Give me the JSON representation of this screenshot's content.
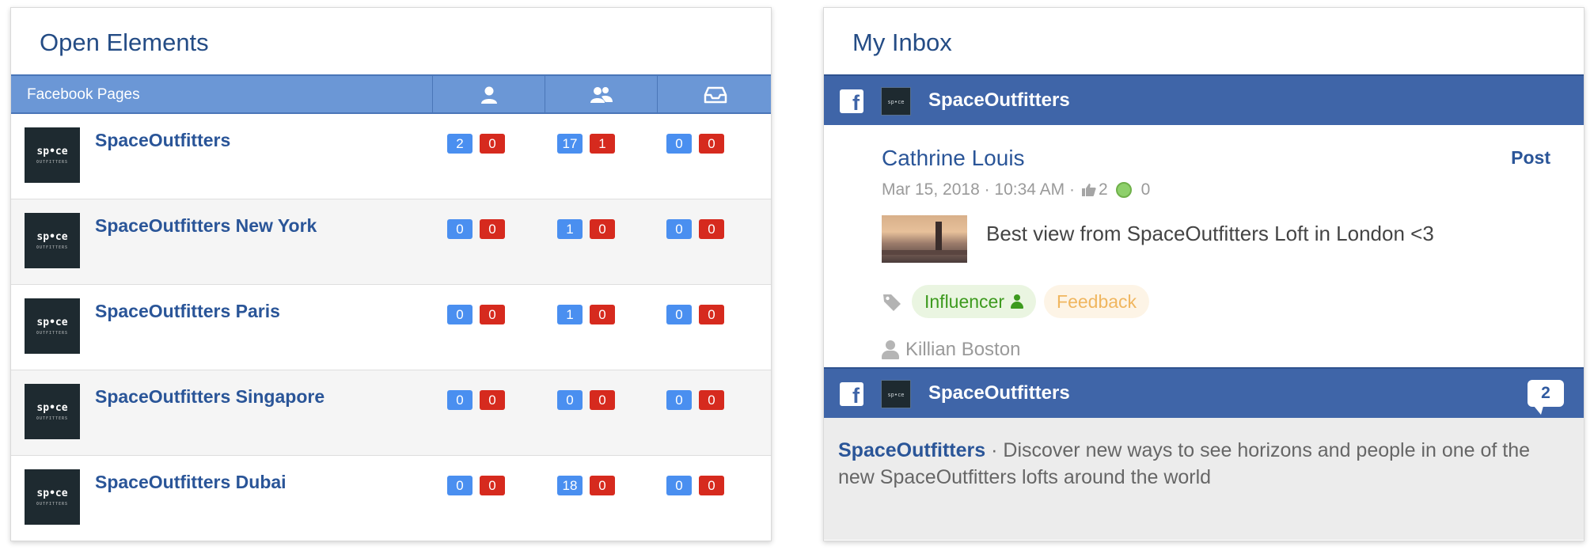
{
  "left_panel": {
    "title": "Open Elements",
    "table": {
      "header_label": "Facebook Pages",
      "column_icons": [
        "single-user-icon",
        "multiple-users-icon",
        "inbox-tray-icon"
      ],
      "rows": [
        {
          "logo_text": "sp•ce",
          "name": "SpaceOutfitters",
          "c1": [
            "2",
            "0"
          ],
          "c2": [
            "17",
            "1"
          ],
          "c3": [
            "0",
            "0"
          ]
        },
        {
          "logo_text": "sp•ce",
          "name": "SpaceOutfitters New York",
          "c1": [
            "0",
            "0"
          ],
          "c2": [
            "1",
            "0"
          ],
          "c3": [
            "0",
            "0"
          ]
        },
        {
          "logo_text": "sp•ce",
          "name": "SpaceOutfitters Paris",
          "c1": [
            "0",
            "0"
          ],
          "c2": [
            "1",
            "0"
          ],
          "c3": [
            "0",
            "0"
          ]
        },
        {
          "logo_text": "sp•ce",
          "name": "SpaceOutfitters Singapore",
          "c1": [
            "0",
            "0"
          ],
          "c2": [
            "0",
            "0"
          ],
          "c3": [
            "0",
            "0"
          ]
        },
        {
          "logo_text": "sp•ce",
          "name": "SpaceOutfitters Dubai",
          "c1": [
            "0",
            "0"
          ],
          "c2": [
            "18",
            "0"
          ],
          "c3": [
            "0",
            "0"
          ]
        }
      ]
    }
  },
  "right_panel": {
    "title": "My Inbox",
    "items": [
      {
        "source_icon": "facebook-icon",
        "page_name": "SpaceOutfitters",
        "post": {
          "author": "Cathrine Louis",
          "type": "Post",
          "timestamp": "Mar 15, 2018 · 10:34 AM ·",
          "likes": "2",
          "sentiment_count": "0",
          "text": "Best view from SpaceOutfitters Loft in London <3",
          "tags": [
            "Influencer",
            "Feedback"
          ],
          "assignee": "Killian Boston"
        }
      },
      {
        "source_icon": "facebook-icon",
        "page_name": "SpaceOutfitters",
        "comment_count": "2",
        "preview_page": "SpaceOutfitters",
        "preview_text": " · Discover new ways to see horizons and people in one of the new SpaceOutfitters lofts around the world"
      }
    ]
  },
  "colors": {
    "header_blue": "#6b97d6",
    "facebook_blue": "#3f65a8",
    "badge_blue": "#4a8ff0",
    "badge_red": "#d62a1e",
    "link_blue": "#2a5598",
    "influencer_green": "#3d9a1e",
    "feedback_orange": "#f0b65f"
  }
}
